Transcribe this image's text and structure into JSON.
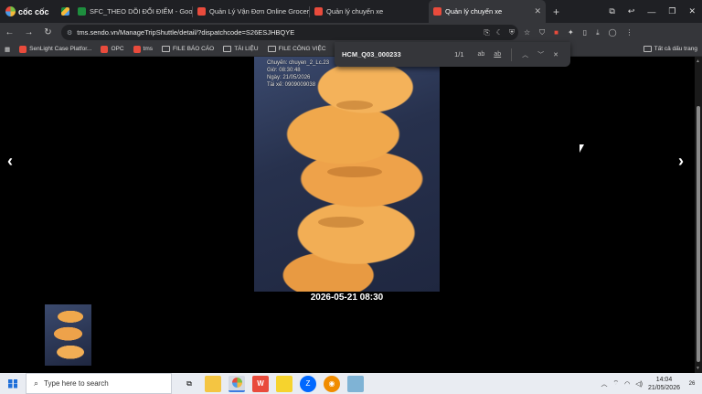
{
  "browser": {
    "brand": "cốc cốc",
    "tabs": [
      {
        "label": "",
        "color": "#4c9be8"
      },
      {
        "label": "SFC_THEO DÕI ĐỔI ĐIỂM - Goo",
        "color": "#1e8e3e"
      },
      {
        "label": "Quản Lý Vận Đơn Online Grocer",
        "color": "#e94b3c"
      },
      {
        "label": "Quản lý chuyến xe",
        "color": "#e94b3c"
      },
      {
        "label": "Quản lý chuyến xe",
        "color": "#e94b3c",
        "active": true
      }
    ],
    "new_tab": "+",
    "url": "tms.sendo.vn/ManageTripShuttle/detail/?dispatchcode=S26ESJHBQYE",
    "bookmarks": [
      {
        "label": "SenLight Case Platfor...",
        "type": "site",
        "color": "#e94b3c"
      },
      {
        "label": "OPC",
        "type": "site",
        "color": "#e94b3c"
      },
      {
        "label": "tms",
        "type": "site",
        "color": "#e94b3c"
      },
      {
        "label": "FILE BÁO CÁO",
        "type": "folder"
      },
      {
        "label": "TÀI LIỆU",
        "type": "folder"
      },
      {
        "label": "FILE CÔNG VIỆC",
        "type": "folder"
      }
    ],
    "bookmarks_all": "Tất cả dấu trang"
  },
  "find": {
    "query": "HCM_Q03_000233",
    "count": "1/1",
    "match_case": "ab",
    "whole_word": "ab"
  },
  "viewer": {
    "watermark_lines": [
      "Chuyến: chuyen_2_Lc.23",
      "Giờ: 08:30:48",
      "Ngày: 21/05/2026",
      "Tài xế: 0909009038"
    ],
    "caption": "2026-05-21 08:30",
    "prev": "‹",
    "next": "›"
  },
  "taskbar": {
    "search_placeholder": "Type here to search",
    "time": "14:04",
    "date": "21/05/2026",
    "notifications": "26"
  }
}
